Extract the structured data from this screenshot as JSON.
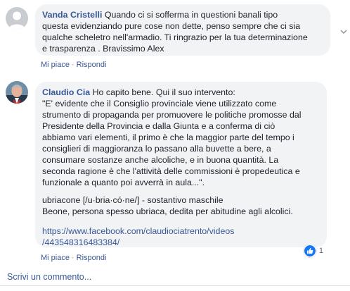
{
  "comments": [
    {
      "author": "Vanda Cristelli",
      "text": " Quando ci si sofferma in questioni banali tipo\nquesta evidenziando pure cose non dette, penso sempre che ci sia\nqualche scheletro nell'armadio. Ti ringrazio per la tua determinazione\ne trasparenza . Bravissimo Alex",
      "actions": {
        "like": "Mi piace",
        "sep": "·",
        "reply": "Rispondi"
      }
    },
    {
      "author": "Claudio Cia",
      "intro": " Ho capito bene. Qui il suo intervento:",
      "quote": "\"E' evidente che il Consiglio provinciale viene utilizzato come\nstrumento di propaganda per promuovere le politiche promosse dal\nPresidente della Provincia e dalla Giunta e a conferma di ciò\nabbiamo vari elementi, il primo è che la maggior parte del tempo i\nconsiglieri di maggioranza lo passano alla buvette a bere, a\nconsumare sostanze anche alcoliche, e in buona quantità. La\nseconda ragione è che l'attività delle commissioni è propedeutica e\nfunzionale a quanto poi avverrà in aula...\".",
      "definition": "ubriacone [/u·bria·có·ne/] - sostantivo maschile\nBeone, persona spesso ubriaca, dedita per abitudine agli alcolici.",
      "url_line1": "https://www.facebook.com/claudiociatrento/videos",
      "url_line2": "/443548316483384/",
      "actions": {
        "like": "Mi piace",
        "sep": "·",
        "reply": "Rispondi"
      },
      "reaction_count": "1"
    }
  ],
  "write_comment": "Scrivi un commento...",
  "colors": {
    "link": "#385898",
    "bubble": "#f2f3f5",
    "like": "#1877f2"
  }
}
